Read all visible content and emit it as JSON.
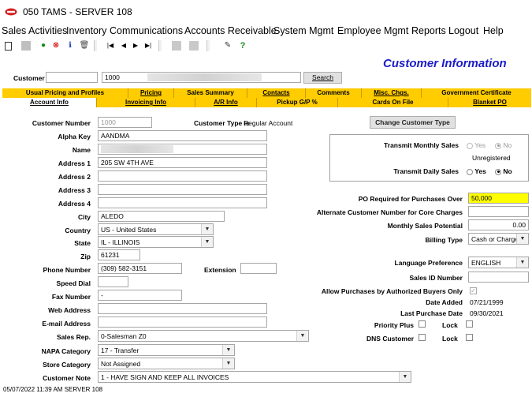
{
  "window": {
    "title": "050 TAMS - SERVER 108"
  },
  "menu": [
    "Sales Activities",
    "Inventory",
    "Communications",
    "Accounts Receivable",
    "System Mgmt",
    "Employee Mgmt",
    "Reports",
    "Logout",
    "Help"
  ],
  "toolbar": {
    "help_glyph": "?"
  },
  "header": {
    "title": "Customer Information",
    "customer_label": "Customer",
    "customer_number": "1000",
    "search_label": "Search"
  },
  "tabs_top": [
    "Usual Pricing and Profiles",
    "Pricing",
    "Sales Summary",
    "Contacts",
    "Comments",
    "Misc. Chgs.",
    "Government Certificate"
  ],
  "tabs_bottom": [
    "Account Info",
    "Invoicing Info",
    "A/R Info",
    "Pickup G/P %",
    "Cards On File",
    "Blanket PO"
  ],
  "left": {
    "customer_number_label": "Customer Number",
    "customer_number": "1000",
    "customer_type_label": "Customer Type is",
    "customer_type": "Regular Account",
    "alpha_key_label": "Alpha Key",
    "alpha_key": "AANDMA",
    "name_label": "Name",
    "address1_label": "Address 1",
    "address1": "205 SW 4TH AVE",
    "address2_label": "Address 2",
    "address3_label": "Address 3",
    "address4_label": "Address 4",
    "city_label": "City",
    "city": "ALEDO",
    "country_label": "Country",
    "country": "US - United States",
    "state_label": "State",
    "state": "IL - ILLINOIS",
    "zip_label": "Zip",
    "zip": "61231",
    "phone_label": "Phone Number",
    "phone": "(309) 582-3151",
    "extension_label": "Extension",
    "speed_dial_label": "Speed Dial",
    "fax_label": "Fax Number",
    "fax": "-",
    "web_label": "Web Address",
    "email_label": "E-mail Address",
    "sales_rep_label": "Sales Rep.",
    "sales_rep": "0-Salesman Z0",
    "napa_label": "NAPA Category",
    "napa": "17 - Transfer",
    "store_label": "Store Category",
    "store": "Not Assigned",
    "note_label": "Customer Note",
    "note": "1 - HAVE SIGN AND KEEP ALL INVOICES"
  },
  "right": {
    "change_type_button": "Change Customer Type",
    "transmit_monthly_label": "Transmit Monthly Sales",
    "yes": "Yes",
    "no": "No",
    "unregistered": "Unregistered",
    "transmit_daily_label": "Transmit Daily Sales",
    "po_label": "PO Required for Purchases Over",
    "po_value": "50,000",
    "alt_cust_label": "Alternate Customer Number for Core Charges",
    "monthly_potential_label": "Monthly Sales Potential",
    "monthly_potential": "0.00",
    "billing_type_label": "Billing Type",
    "billing_type": "Cash or Charge",
    "language_label": "Language Preference",
    "language": "ENGLISH",
    "sales_id_label": "Sales ID Number",
    "authorized_label": "Allow Purchases by Authorized Buyers Only",
    "date_added_label": "Date Added",
    "date_added": "07/21/1999",
    "last_purchase_label": "Last Purchase Date",
    "last_purchase": "09/30/2021",
    "priority_plus_label": "Priority Plus",
    "lock_label": "Lock",
    "dns_label": "DNS Customer"
  },
  "status": {
    "text": "05/07/2022 11:39 AM  SERVER 108"
  },
  "colors": {
    "tab_bar": "#ffcc00",
    "title_blue": "#1c1cc8",
    "highlight": "#ffff00"
  }
}
